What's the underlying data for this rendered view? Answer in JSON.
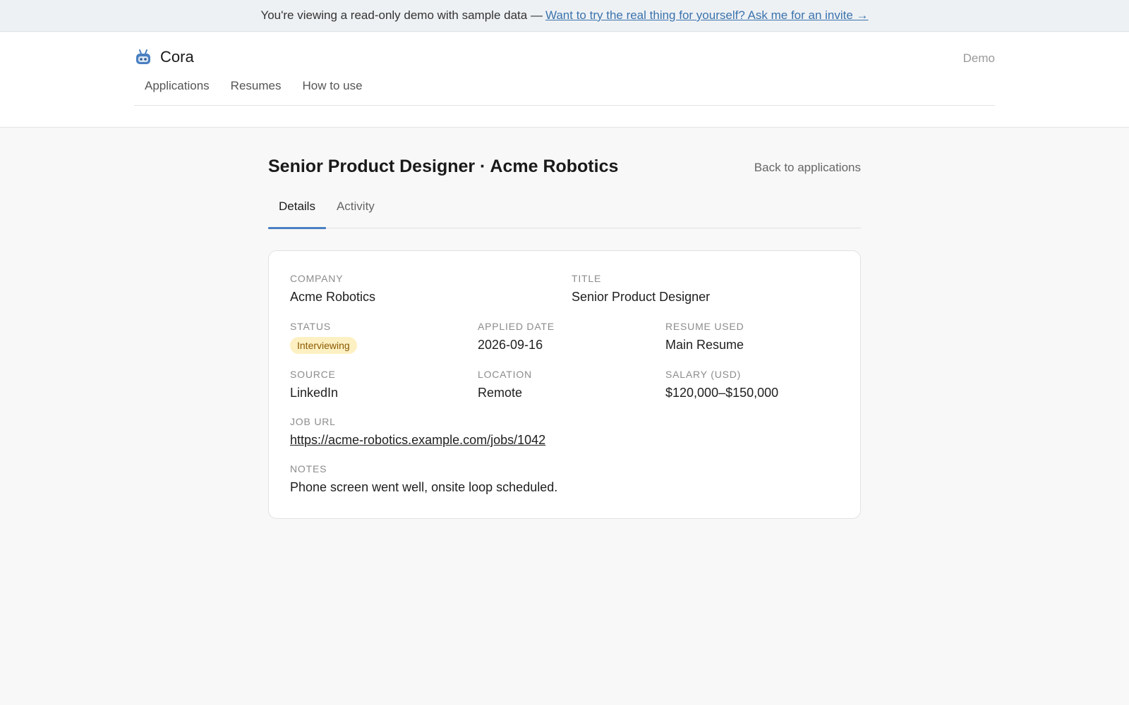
{
  "banner": {
    "text": "You're viewing a read-only demo with sample data —",
    "link": "Want to try the real thing for yourself? Ask me for an invite →"
  },
  "header": {
    "app_name": "Cora",
    "logo_icon": "robot-icon",
    "demo_label": "Demo",
    "nav": [
      "Applications",
      "Resumes",
      "How to use"
    ]
  },
  "page": {
    "title": "Senior Product Designer · Acme Robotics",
    "back_label": "Back to applications",
    "tabs": [
      "Details",
      "Activity"
    ],
    "active_tab": "Details"
  },
  "details": {
    "company": {
      "label": "Company",
      "value": "Acme Robotics"
    },
    "title": {
      "label": "Title",
      "value": "Senior Product Designer"
    },
    "status": {
      "label": "Status",
      "value": "Interviewing"
    },
    "applied_date": {
      "label": "Applied Date",
      "value": "2026-09-16"
    },
    "resume_used": {
      "label": "Resume Used",
      "value": "Main Resume"
    },
    "source": {
      "label": "Source",
      "value": "LinkedIn"
    },
    "location": {
      "label": "Location",
      "value": "Remote"
    },
    "salary": {
      "label": "Salary (USD)",
      "value": "$120,000–$150,000"
    },
    "job_url": {
      "label": "Job URL",
      "value": "https://acme-robotics.example.com/jobs/1042"
    },
    "notes": {
      "label": "Notes",
      "value": "Phone screen went well, onsite loop scheduled."
    }
  },
  "colors": {
    "accent": "#4a7fc1",
    "link": "#3b73ad",
    "status_badge_bg": "#fdf0c2",
    "status_badge_text": "#8a5a00"
  }
}
